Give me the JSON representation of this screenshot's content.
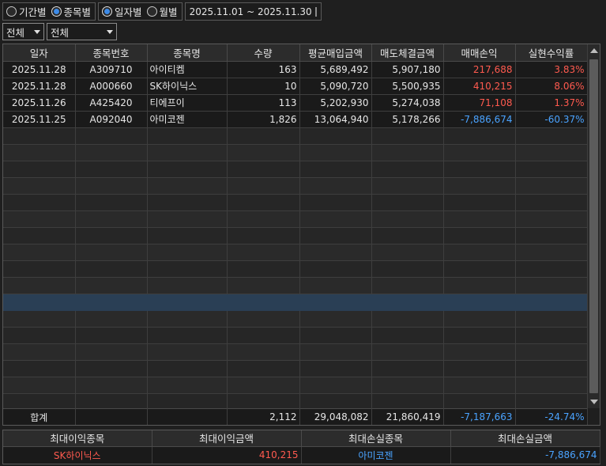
{
  "filters": {
    "range_mode": [
      {
        "label": "기간별",
        "selected": false
      },
      {
        "label": "종목별",
        "selected": true
      }
    ],
    "time_mode": [
      {
        "label": "일자별",
        "selected": true
      },
      {
        "label": "월별",
        "selected": false
      }
    ],
    "date_range": "2025.11.01 ~ 2025.11.30",
    "dropdown1": "전체",
    "dropdown2": "전체"
  },
  "table": {
    "headers": [
      "일자",
      "종목번호",
      "종목명",
      "수량",
      "평균매입금액",
      "매도체결금액",
      "매매손익",
      "실현수익률"
    ],
    "rows": [
      {
        "date": "2025.11.28",
        "code": "A309710",
        "name": "아이티켐",
        "qty": "163",
        "avg_buy": "5,689,492",
        "sell_amt": "5,907,180",
        "pnl": "217,688",
        "rate": "3.83%",
        "sign": "pos"
      },
      {
        "date": "2025.11.28",
        "code": "A000660",
        "name": "SK하이닉스",
        "qty": "10",
        "avg_buy": "5,090,720",
        "sell_amt": "5,500,935",
        "pnl": "410,215",
        "rate": "8.06%",
        "sign": "pos"
      },
      {
        "date": "2025.11.26",
        "code": "A425420",
        "name": "티에프이",
        "qty": "113",
        "avg_buy": "5,202,930",
        "sell_amt": "5,274,038",
        "pnl": "71,108",
        "rate": "1.37%",
        "sign": "pos"
      },
      {
        "date": "2025.11.25",
        "code": "A092040",
        "name": "아미코젠",
        "qty": "1,826",
        "avg_buy": "13,064,940",
        "sell_amt": "5,178,266",
        "pnl": "-7,886,674",
        "rate": "-60.37%",
        "sign": "neg"
      }
    ],
    "total": {
      "label": "합계",
      "qty": "2,112",
      "avg_buy": "29,048,082",
      "sell_amt": "21,860,419",
      "pnl": "-7,187,663",
      "rate": "-24.74%"
    }
  },
  "summary": {
    "headers": [
      "최대이익종목",
      "최대이익금액",
      "최대손실종목",
      "최대손실금액"
    ],
    "max_profit_name": "SK하이닉스",
    "max_profit_amount": "410,215",
    "max_loss_name": "아미코젠",
    "max_loss_amount": "-7,886,674"
  },
  "colors": {
    "positive": "#ff5a4f",
    "negative": "#4aa3ff",
    "selection": "#2a3f55",
    "accent_radio": "#3d8be8"
  }
}
